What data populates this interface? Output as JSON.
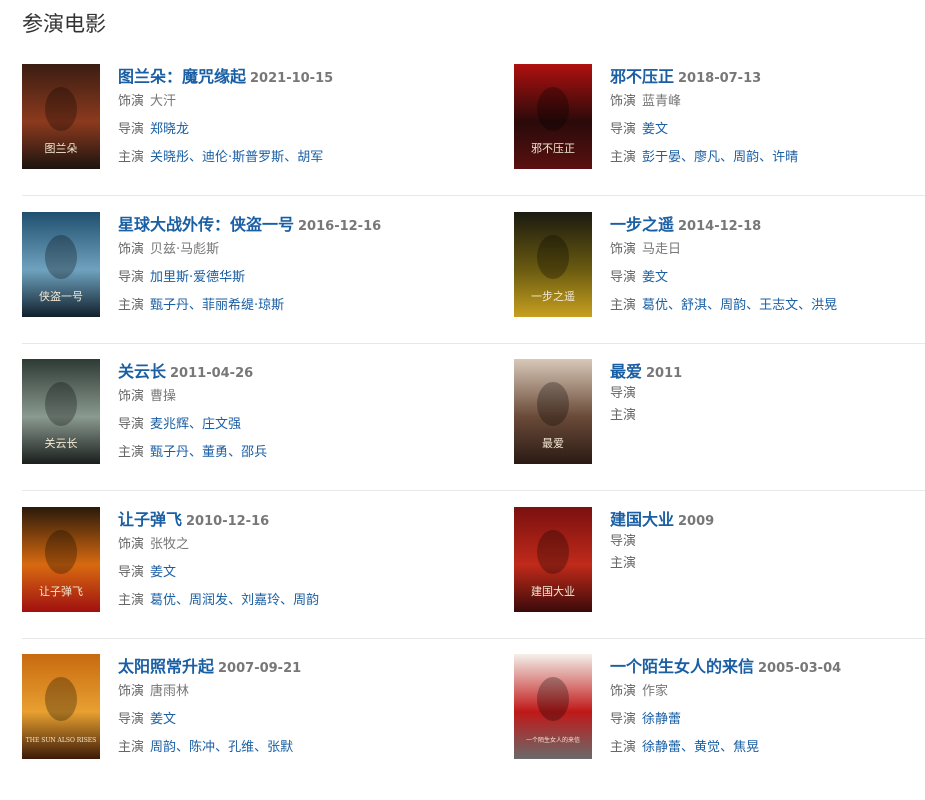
{
  "section_title": "参演电影",
  "labels": {
    "role": "饰演",
    "director": "导演",
    "cast": "主演"
  },
  "movies": [
    {
      "title": "图兰朵：魔咒缘起",
      "date": "2021-10-15",
      "role": "大汗",
      "director": "郑晓龙",
      "cast": [
        "关晓彤",
        "迪伦·斯普罗斯",
        "胡军"
      ],
      "poster_text": "图兰朵",
      "poster_colors": [
        "#3a1d12",
        "#8c3a1e",
        "#1c1410"
      ]
    },
    {
      "title": "邪不压正",
      "date": "2018-07-13",
      "role": "蓝青峰",
      "director": "姜文",
      "cast": [
        "彭于晏",
        "廖凡",
        "周韵",
        "许晴"
      ],
      "poster_text": "邪不压正",
      "poster_colors": [
        "#b01010",
        "#2a0a0a",
        "#5a1010"
      ]
    },
    {
      "title": "星球大战外传：侠盗一号",
      "date": "2016-12-16",
      "role": "贝兹·马彪斯",
      "director": "加里斯·爱德华斯",
      "cast": [
        "甄子丹",
        "菲丽希缇·琼斯"
      ],
      "poster_text": "侠盗一号",
      "poster_colors": [
        "#1f4f6e",
        "#6fa2bf",
        "#10202c"
      ]
    },
    {
      "title": "一步之遥",
      "date": "2014-12-18",
      "role": "马走日",
      "director": "姜文",
      "cast": [
        "葛优",
        "舒淇",
        "周韵",
        "王志文",
        "洪晃"
      ],
      "poster_text": "一步之遥",
      "poster_colors": [
        "#1a1a10",
        "#6a5a10",
        "#c8a020"
      ]
    },
    {
      "title": "关云长",
      "date": "2011-04-26",
      "role": "曹操",
      "director": "",
      "directors": [
        "麦兆辉",
        "庄文强"
      ],
      "cast": [
        "甄子丹",
        "董勇",
        "邵兵"
      ],
      "poster_text": "关云长",
      "poster_colors": [
        "#2e3a34",
        "#8a9a90",
        "#1a1e1c"
      ]
    },
    {
      "title": "最爱",
      "date": "2011",
      "role": "",
      "director": "",
      "cast": [],
      "poster_text": "最爱",
      "poster_colors": [
        "#d8c8b8",
        "#6a4a38",
        "#2a1a14"
      ]
    },
    {
      "title": "让子弹飞",
      "date": "2010-12-16",
      "role": "张牧之",
      "director": "姜文",
      "cast": [
        "葛优",
        "周润发",
        "刘嘉玲",
        "周韵"
      ],
      "poster_text": "让子弹飞",
      "poster_colors": [
        "#2a1a0a",
        "#d86a10",
        "#a01010"
      ]
    },
    {
      "title": "建国大业",
      "date": "2009",
      "role": "",
      "director": "",
      "cast": [],
      "poster_text": "建国大业",
      "poster_colors": [
        "#7a1010",
        "#c02a1a",
        "#3a0a0a"
      ]
    },
    {
      "title": "太阳照常升起",
      "date": "2007-09-21",
      "role": "唐雨林",
      "director": "姜文",
      "cast": [
        "周韵",
        "陈冲",
        "孔维",
        "张默"
      ],
      "poster_text": "THE SUN ALSO RISES",
      "poster_colors": [
        "#c86a10",
        "#e8a030",
        "#3a1a08"
      ]
    },
    {
      "title": "一个陌生女人的来信",
      "date": "2005-03-04",
      "role": "作家",
      "director": "徐静蕾",
      "cast": [
        "徐静蕾",
        "黄觉",
        "焦晃"
      ],
      "poster_text": "一个陌生女人的来信",
      "poster_colors": [
        "#f4f0ea",
        "#c01818",
        "#6a6a6a"
      ]
    }
  ]
}
